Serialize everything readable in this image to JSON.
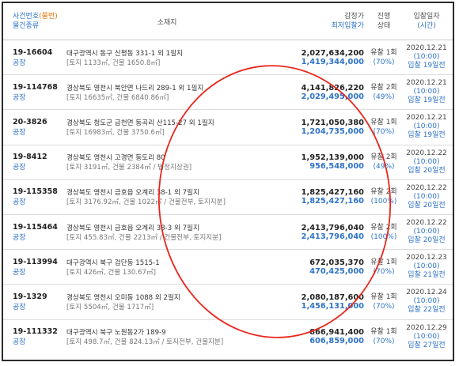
{
  "header": {
    "case_label": "사건번호",
    "case_label_suffix": "(물번)",
    "case_type_label": "물건종류",
    "location_label": "소재지",
    "appraisal_label": "감정가",
    "minbid_label": "최저입찰가",
    "status_label_1": "진행",
    "status_label_2": "상태",
    "date_label": "입찰일자",
    "time_label": "(시간)"
  },
  "rows": [
    {
      "case_no": "19-16604",
      "type": "공장",
      "address": "대구광역시 동구 신평동 331-1 외 1필지",
      "detail": "[토지 1133㎡, 건물 1650.8㎡]",
      "appraisal": "2,027,634,200",
      "minbid": "1,419,344,000",
      "status": "유찰 1회",
      "pct": "(70%)",
      "date": "2020.12.21",
      "time": "(10:00)",
      "remain": "입찰 19일전"
    },
    {
      "case_no": "19-114768",
      "type": "공장",
      "address": "경상북도 영천시 북안면 나드리 289-1 외 1필지",
      "detail": "[토지 16635㎡, 건물 6840.86㎡]",
      "appraisal": "4,141,826,220",
      "minbid": "2,029,495,000",
      "status": "유찰 2회",
      "pct": "(49%)",
      "date": "2020.12.21",
      "time": "(10:00)",
      "remain": "입찰 19일전"
    },
    {
      "case_no": "20-3826",
      "type": "공장",
      "address": "경상북도 청도군 금천면 동곡리 산115-27 외 1필지",
      "detail": "[토지 16983㎡, 건물 3750.6㎡]",
      "appraisal": "1,721,050,380",
      "minbid": "1,204,735,000",
      "status": "유찰 1회",
      "pct": "(70%)",
      "date": "2020.12.21",
      "time": "(10:00)",
      "remain": "입찰 19일전"
    },
    {
      "case_no": "19-8412",
      "type": "공장",
      "address": "경상북도 영천시 고경면 동도리 80",
      "detail": "[토지 3191㎡, 건물 2384㎡ / 법정지상권]",
      "appraisal": "1,952,139,000",
      "minbid": "956,548,000",
      "status": "유찰 2회",
      "pct": "(49%)",
      "date": "2020.12.22",
      "time": "(10:00)",
      "remain": "입찰 20일전"
    },
    {
      "case_no": "19-115358",
      "type": "공장",
      "address": "경상북도 영천시 금호읍 오계리 38-1 외 7필지",
      "detail": "[토지 3176.92㎡, 건물 1022㎡ / 건물전부, 토지지분]",
      "appraisal": "1,825,427,160",
      "minbid": "1,825,427,160",
      "status": "유찰 2회",
      "pct": "(100%)",
      "date": "2020.12.22",
      "time": "(10:00)",
      "remain": "입찰 20일전"
    },
    {
      "case_no": "19-115464",
      "type": "공장",
      "address": "경상북도 영천시 금호읍 오계리 38-3 외 7필지",
      "detail": "[토지 455.83㎡, 건물 2213㎡ / 건물전부, 토지지분]",
      "appraisal": "2,413,796,040",
      "minbid": "2,413,796,040",
      "status": "유찰 2회",
      "pct": "(100%)",
      "date": "2020.12.22",
      "time": "(10:00)",
      "remain": "입찰 20일전"
    },
    {
      "case_no": "19-113994",
      "type": "공장",
      "address": "대구광역시 북구 검단동 1515-1",
      "detail": "[토지 426㎡, 건물 130.67㎡]",
      "appraisal": "672,035,370",
      "minbid": "470,425,000",
      "status": "유찰 1회",
      "pct": "(70%)",
      "date": "2020.12.23",
      "time": "(10:00)",
      "remain": "입찰 21일전"
    },
    {
      "case_no": "19-1329",
      "type": "공장",
      "address": "경상북도 영천시 오미동 1088 외 2필지",
      "detail": "[토지 5504㎡, 건물 1717㎡]",
      "appraisal": "2,080,187,600",
      "minbid": "1,456,131,000",
      "status": "유찰 1회",
      "pct": "(70%)",
      "date": "2020.12.24",
      "time": "(10:00)",
      "remain": "입찰 22일전"
    },
    {
      "case_no": "19-111332",
      "type": "공장",
      "address": "대구광역시 북구 노원동2가 189-9",
      "detail": "[토지 498.7㎡, 건물 824.13㎡ / 토지전부, 건물지분]",
      "appraisal": "866,941,400",
      "minbid": "606,859,000",
      "status": "유찰 1회",
      "pct": "(70%)",
      "date": "2020.12.29",
      "time": "(10:00)",
      "remain": "입찰 27일전"
    }
  ],
  "colors": {
    "accent_blue": "#2e72c9",
    "accent_orange": "#e8730b",
    "annotation_red": "#e8261c",
    "frame": "#2b2b2b"
  }
}
